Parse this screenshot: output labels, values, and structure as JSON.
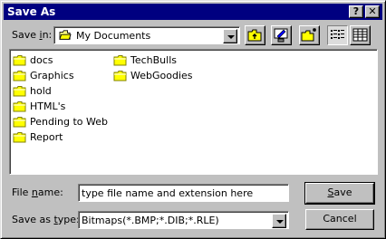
{
  "window": {
    "title": "Save As"
  },
  "titlebar": {
    "help_label": "?",
    "close_label": "✕"
  },
  "save_in": {
    "label_pre": "Save ",
    "label_ul": "i",
    "label_post": "n:",
    "value": "My Documents"
  },
  "toolbar": {
    "up_folder": "up-one-level",
    "desktop": "desktop",
    "new_folder": "create-new-folder",
    "list_view": "list",
    "details_view": "details"
  },
  "files": {
    "column1": [
      "docs",
      "Graphics",
      "hold",
      "HTML's",
      "Pending to Web",
      "Report"
    ],
    "column2": [
      "TechBulls",
      "WebGoodies"
    ]
  },
  "file_name": {
    "label_pre": "File ",
    "label_ul": "n",
    "label_post": "ame:",
    "value": "type file name and extension here"
  },
  "save_as_type": {
    "label_pre": "Save as ",
    "label_ul": "t",
    "label_post": "ype:",
    "value": "Bitmaps(*.BMP;*.DIB;*.RLE)"
  },
  "buttons": {
    "save_ul": "S",
    "save_rest": "ave",
    "cancel": "Cancel"
  },
  "colors": {
    "titlebar": "#000080",
    "face": "#c0c0c0",
    "folder": "#ffff00"
  }
}
